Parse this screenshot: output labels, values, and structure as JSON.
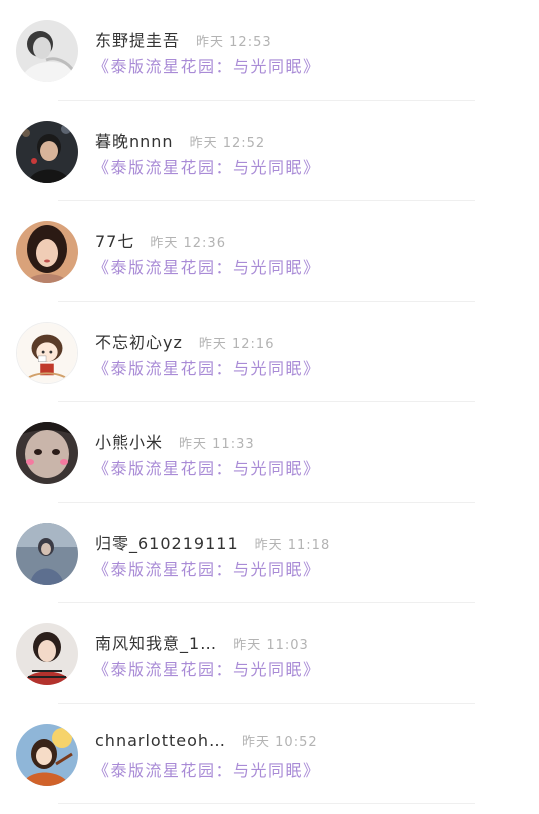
{
  "messages": [
    {
      "name": "东野提圭吾",
      "time": "昨天 12:53",
      "text": "《泰版流星花园：与光同眠》",
      "avatar": "avatar-photo"
    },
    {
      "name": "暮晚nnnn",
      "time": "昨天 12:52",
      "text": "《泰版流星花园：与光同眠》",
      "avatar": "avatar-photo"
    },
    {
      "name": "77七",
      "time": "昨天 12:36",
      "text": "《泰版流星花园：与光同眠》",
      "avatar": "avatar-photo"
    },
    {
      "name": "不忘初心yz",
      "time": "昨天 12:16",
      "text": "《泰版流星花园：与光同眠》",
      "avatar": "avatar-cartoon"
    },
    {
      "name": "小熊小米",
      "time": "昨天 11:33",
      "text": "《泰版流星花园：与光同眠》",
      "avatar": "avatar-photo"
    },
    {
      "name": "归零_610219111",
      "time": "昨天 11:18",
      "text": "《泰版流星花园：与光同眠》",
      "avatar": "avatar-photo"
    },
    {
      "name": "南风知我意_1…",
      "time": "昨天 11:03",
      "text": "《泰版流星花园：与光同眠》",
      "avatar": "avatar-photo"
    },
    {
      "name": "chnarlotteoh…",
      "time": "昨天 10:52",
      "text": "《泰版流星花园：与光同眠》",
      "avatar": "avatar-illustration"
    }
  ],
  "colors": {
    "name": "#333333",
    "time": "#b3b3b3",
    "message": "#a98bd6",
    "divider": "#efefef"
  }
}
